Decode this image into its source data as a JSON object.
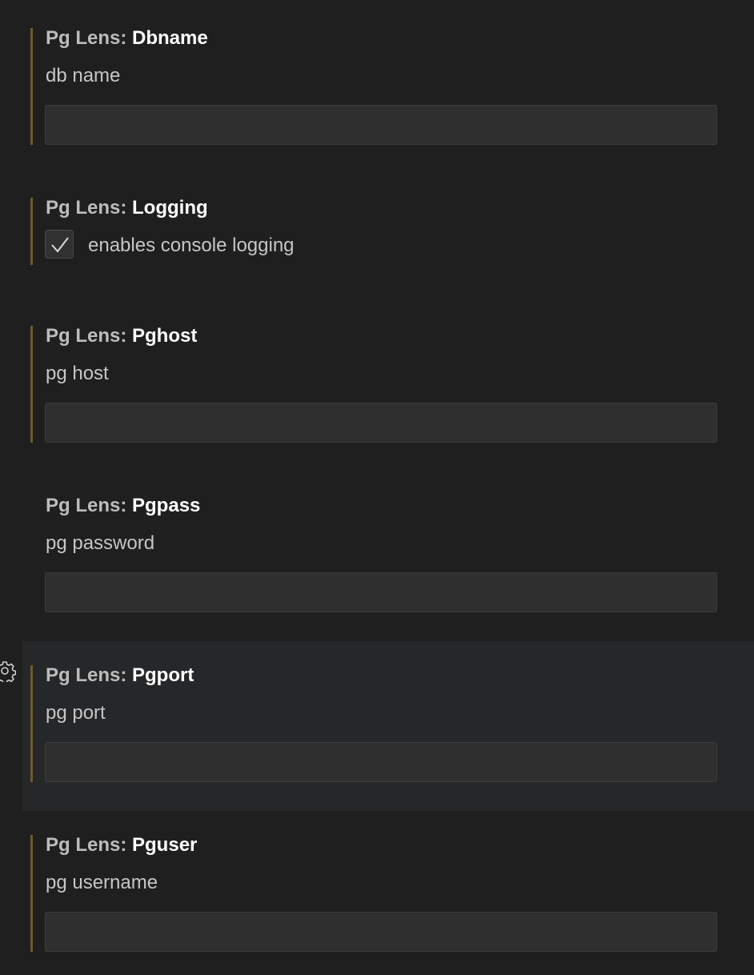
{
  "settings": [
    {
      "prefix": "Pg Lens: ",
      "name": "Dbname",
      "description": "db name",
      "type": "text",
      "value": "",
      "modified": true
    },
    {
      "prefix": "Pg Lens: ",
      "name": "Logging",
      "description": "enables console logging",
      "type": "checkbox",
      "checked": true,
      "modified": true
    },
    {
      "prefix": "Pg Lens: ",
      "name": "Pghost",
      "description": "pg host",
      "type": "text",
      "value": "",
      "modified": true
    },
    {
      "prefix": "Pg Lens: ",
      "name": "Pgpass",
      "description": "pg password",
      "type": "text",
      "value": "",
      "modified": false
    },
    {
      "prefix": "Pg Lens: ",
      "name": "Pgport",
      "description": "pg port",
      "type": "text",
      "value": "",
      "modified": true,
      "hovered": true
    },
    {
      "prefix": "Pg Lens: ",
      "name": "Pguser",
      "description": "pg username",
      "type": "text",
      "value": "",
      "modified": true
    }
  ],
  "icons": {
    "gear": "gear-icon",
    "check": "checkmark-icon"
  },
  "colors": {
    "background": "#1f1f1f",
    "hover_background": "#262729",
    "modified_indicator": "#6f5a2e",
    "input_background": "#2f2f2f"
  }
}
